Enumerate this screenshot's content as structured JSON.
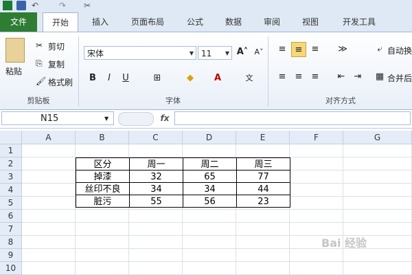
{
  "tabs": [
    {
      "label": "文件"
    },
    {
      "label": "开始"
    },
    {
      "label": "插入"
    },
    {
      "label": "页面布局"
    },
    {
      "label": "公式"
    },
    {
      "label": "数据"
    },
    {
      "label": "审阅"
    },
    {
      "label": "视图"
    },
    {
      "label": "开发工具"
    }
  ],
  "ribbon": {
    "clipboard": {
      "paste": "粘贴",
      "cut": "剪切",
      "copy": "复制",
      "format_painter": "格式刷",
      "group": "剪贴板"
    },
    "font": {
      "font_name": "宋体",
      "font_size": "11",
      "bold": "B",
      "italic": "I",
      "underline": "U",
      "group": "字体"
    },
    "align": {
      "wrap_text": "自动换",
      "merge": "合并后",
      "group": "对齐方式"
    }
  },
  "formula_bar": {
    "name_box": "N15",
    "fx": "fx",
    "formula": ""
  },
  "columns": [
    "A",
    "B",
    "C",
    "D",
    "E",
    "F",
    "G"
  ],
  "rows": [
    "1",
    "2",
    "3",
    "4",
    "5",
    "6",
    "7",
    "8",
    "9",
    "10"
  ],
  "table": {
    "header": [
      "区分",
      "周一",
      "周二",
      "周三"
    ],
    "rows": [
      [
        "掉漆",
        "32",
        "65",
        "77"
      ],
      [
        "丝印不良",
        "34",
        "34",
        "44"
      ],
      [
        "脏污",
        "55",
        "56",
        "23"
      ]
    ]
  },
  "watermark": "Bai 经验",
  "colors": {
    "file_tab": "#2e7d32",
    "ribbon_bg": "#dfe8f5",
    "header_bg": "#e4ecf7"
  }
}
